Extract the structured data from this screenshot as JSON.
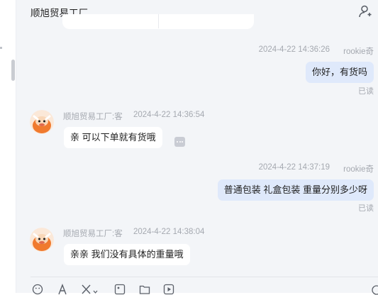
{
  "header": {
    "title": "顺旭贸易工厂"
  },
  "messages": [
    {
      "side": "right",
      "time": "2024-4-22 14:36:26",
      "sender": "rookie奇",
      "text": "你好，有货吗",
      "status": "已读"
    },
    {
      "side": "left",
      "sender": "顺旭贸易工厂:客",
      "time": "2024-4-22 14:36:54",
      "text": "亲 可以下单就有货哦"
    },
    {
      "side": "right",
      "time": "2024-4-22 14:37:19",
      "sender": "rookie奇",
      "text": "普通包装  礼盒包装 重量分别多少呀",
      "status": "已读"
    },
    {
      "side": "left",
      "sender": "顺旭贸易工厂:客",
      "time": "2024-4-22 14:38:04",
      "text": "亲亲 我们没有具体的重量哦"
    }
  ],
  "toolbar": {
    "icons": [
      "emoji-icon",
      "font-icon",
      "scissors-icon",
      "image-icon",
      "folder-icon",
      "video-icon"
    ]
  },
  "colors": {
    "chat_bg": "#f3f5f8",
    "right_bubble": "#dfe9fb",
    "left_bubble": "#ffffff",
    "meta_text": "#a5a9b0",
    "avatar_bg": "#f07a2e"
  }
}
